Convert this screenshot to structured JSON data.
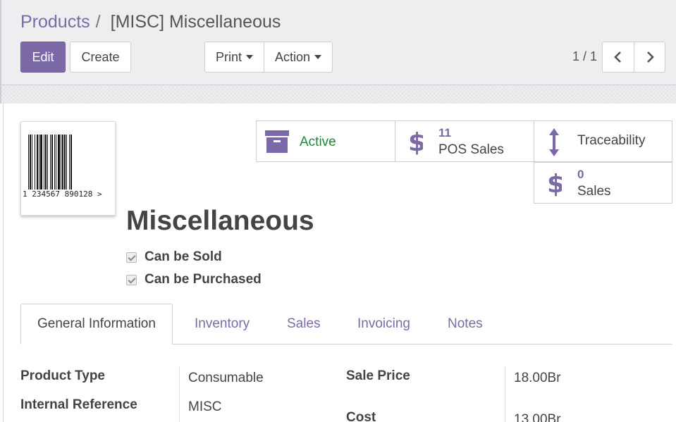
{
  "breadcrumb": {
    "parent": "Products",
    "separator": "/",
    "current": "[MISC] Miscellaneous"
  },
  "toolbar": {
    "edit_label": "Edit",
    "create_label": "Create",
    "print_label": "Print",
    "action_label": "Action"
  },
  "pager": {
    "value": "1 / 1"
  },
  "barcode": {
    "text": "1  234567  890128  >"
  },
  "smart_buttons": {
    "active": {
      "label": "Active",
      "color": "#218838"
    },
    "pos_sales": {
      "value": "11",
      "label": "POS Sales"
    },
    "traceability": {
      "label": "Traceability"
    },
    "sales": {
      "value": "0",
      "label": "Sales"
    }
  },
  "product": {
    "name": "Miscellaneous",
    "can_be_sold_label": "Can be Sold",
    "can_be_purchased_label": "Can be Purchased"
  },
  "tabs": [
    {
      "label": "General Information",
      "active": true
    },
    {
      "label": "Inventory"
    },
    {
      "label": "Sales"
    },
    {
      "label": "Invoicing"
    },
    {
      "label": "Notes"
    }
  ],
  "fields": {
    "product_type": {
      "label": "Product Type",
      "value": "Consumable"
    },
    "internal_reference": {
      "label": "Internal Reference",
      "value": "MISC"
    },
    "sale_price": {
      "label": "Sale Price",
      "value": "18.00Br"
    },
    "cost": {
      "label": "Cost",
      "value": "13.00Br"
    }
  },
  "colors": {
    "accent": "#7c6aa8",
    "active_green": "#218838",
    "control_panel_bg": "#eeedef"
  }
}
